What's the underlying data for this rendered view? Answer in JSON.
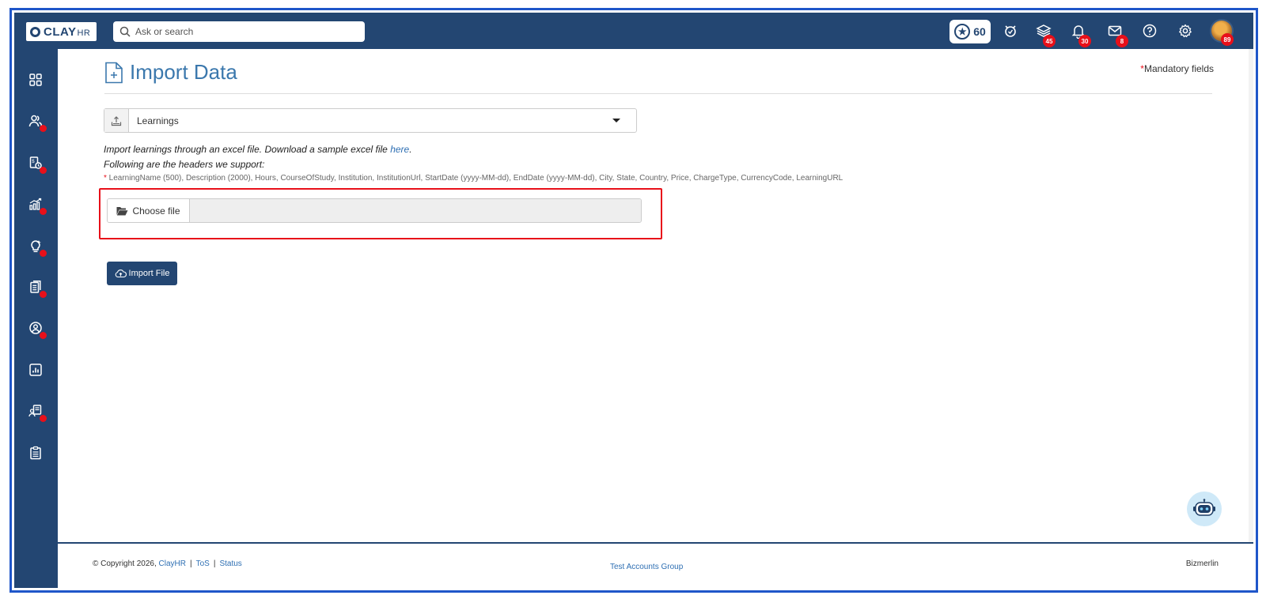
{
  "header": {
    "logo_text": "CLAY",
    "logo_sub": "HR",
    "search_placeholder": "Ask or search",
    "points": "60",
    "badges": {
      "layers": "45",
      "bell": "30",
      "mail": "8",
      "avatar": "89"
    }
  },
  "sidebar": {
    "items": [
      {
        "name": "dashboard",
        "has_dot": false
      },
      {
        "name": "people",
        "has_dot": true
      },
      {
        "name": "time-tracking",
        "has_dot": true
      },
      {
        "name": "performance",
        "has_dot": true
      },
      {
        "name": "ideas",
        "has_dot": true
      },
      {
        "name": "documents",
        "has_dot": true
      },
      {
        "name": "profile",
        "has_dot": true
      },
      {
        "name": "reports",
        "has_dot": false
      },
      {
        "name": "recruiting",
        "has_dot": true
      },
      {
        "name": "checklist",
        "has_dot": false
      }
    ]
  },
  "page": {
    "title": "Import Data",
    "mandatory_label": "Mandatory fields",
    "import_type": "Learnings",
    "info_text": "Import learnings through an excel file. Download a sample excel file ",
    "info_link": "here",
    "info_end": ".",
    "headers_title": "Following are the headers we support:",
    "headers_list": "LearningName (500), Description (2000), Hours, CourseOfStudy, Institution, InstitutionUrl, StartDate (yyyy-MM-dd), EndDate (yyyy-MM-dd), City, State, Country, Price, ChargeType, CurrencyCode, LearningURL",
    "choose_file_label": "Choose file",
    "import_button": "Import File"
  },
  "footer": {
    "copyright": "© Copyright 2026, ",
    "brand_link": "ClayHR",
    "tos_link": "ToS",
    "status_link": "Status",
    "center_link": "Test Accounts Group",
    "right_text": "Bizmerlin"
  },
  "colors": {
    "navy": "#234672",
    "accent_blue": "#3b78ad",
    "badge_red": "#e8101a",
    "highlight_red": "#e8101a"
  }
}
